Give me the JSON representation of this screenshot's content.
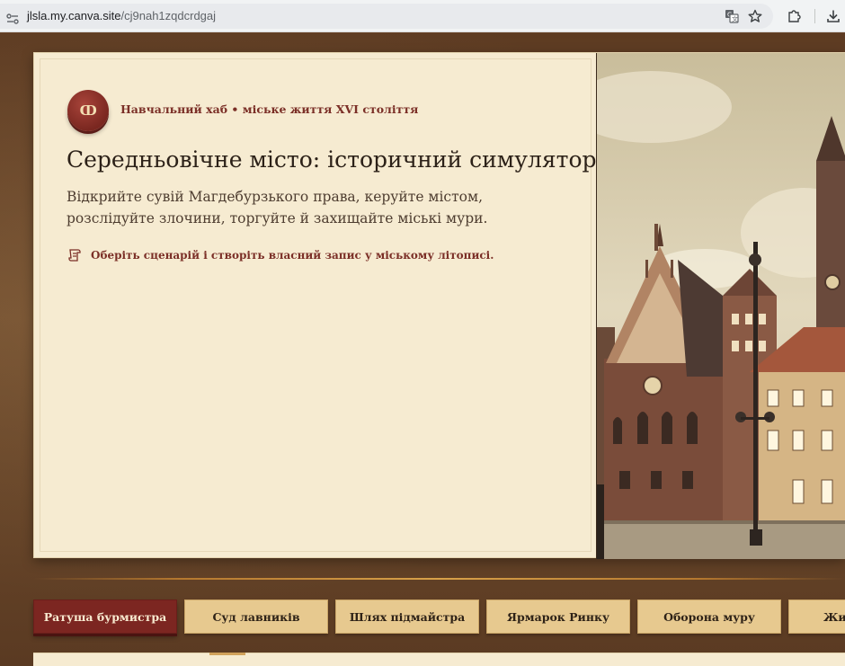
{
  "browser": {
    "url_host": "jlsla.my.canva.site",
    "url_path": "/cj9nah1zqdcrdgaj"
  },
  "hero": {
    "seal_glyph": "ↀ",
    "hub_title": "Навчальний хаб • міське життя XVI століття",
    "title": "Середньовічне місто: історичний симулятор",
    "lead": "Відкрийте сувій Магдебурзького права, керуйте містом, розслідуйте злочини, торгуйте й захищайте міські мури.",
    "tip": "Оберіть сценарій і створіть власний запис у міському літописі."
  },
  "tabs": [
    {
      "label": "Ратуша бурмистра",
      "active": true
    },
    {
      "label": "Суд лавників",
      "active": false
    },
    {
      "label": "Шлях підмайстра",
      "active": false
    },
    {
      "label": "Ярмарок Ринку",
      "active": false
    },
    {
      "label": "Оборона муру",
      "active": false
    },
    {
      "label": "Жит",
      "active": false
    }
  ],
  "colors": {
    "accent": "#7c2621",
    "parchment": "#f6ebd1",
    "tab": "#e7c98f",
    "background": "#6a4529"
  },
  "icons": {
    "seal": "seal-icon",
    "tip": "scroll-icon",
    "translate": "translate-icon",
    "bookmark": "star-icon",
    "extensions": "puzzle-icon",
    "download": "download-icon"
  }
}
